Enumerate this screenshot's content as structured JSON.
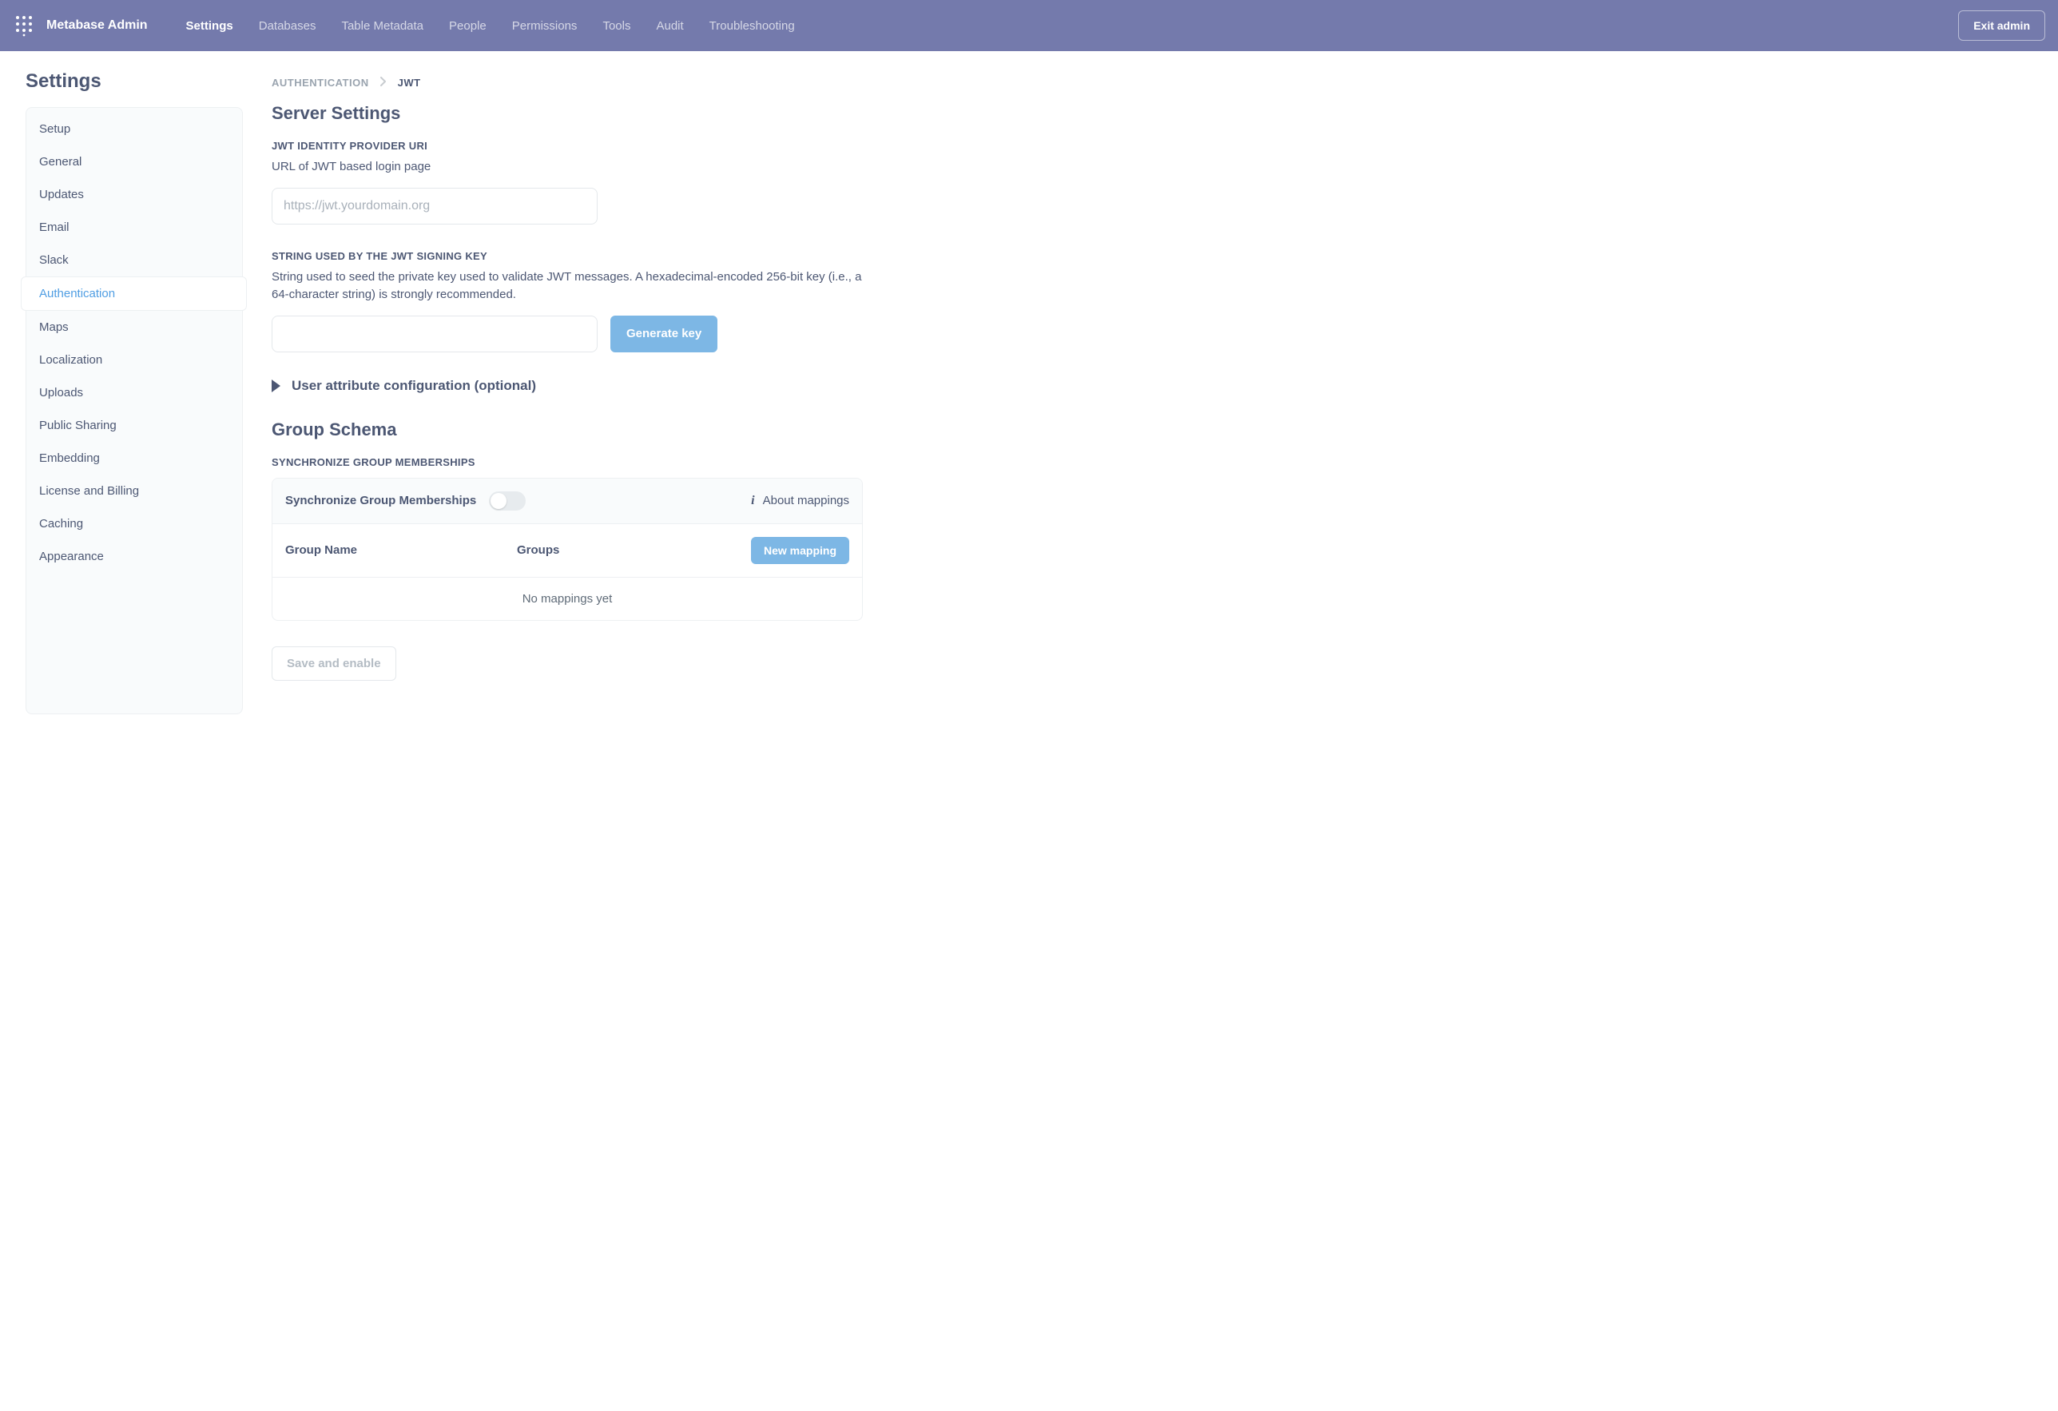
{
  "brand": "Metabase Admin",
  "nav": {
    "items": [
      "Settings",
      "Databases",
      "Table Metadata",
      "People",
      "Permissions",
      "Tools",
      "Audit",
      "Troubleshooting"
    ],
    "active_index": 0
  },
  "exit_label": "Exit admin",
  "page_title": "Settings",
  "sidebar": {
    "items": [
      "Setup",
      "General",
      "Updates",
      "Email",
      "Slack",
      "Authentication",
      "Maps",
      "Localization",
      "Uploads",
      "Public Sharing",
      "Embedding",
      "License and Billing",
      "Caching",
      "Appearance"
    ],
    "active_index": 5
  },
  "breadcrumb": {
    "parent": "AUTHENTICATION",
    "current": "JWT"
  },
  "sections": {
    "server_settings": "Server Settings",
    "group_schema": "Group Schema"
  },
  "jwt_uri": {
    "label": "JWT IDENTITY PROVIDER URI",
    "desc": "URL of JWT based login page",
    "placeholder": "https://jwt.yourdomain.org",
    "value": ""
  },
  "signing_key": {
    "label": "STRING USED BY THE JWT SIGNING KEY",
    "desc": "String used to seed the private key used to validate JWT messages. A hexadecimal-encoded 256-bit key (i.e., a 64-character string) is strongly recommended.",
    "value": "",
    "generate_btn": "Generate key"
  },
  "disclosure": {
    "label": "User attribute configuration (optional)"
  },
  "sync": {
    "section_label": "SYNCHRONIZE GROUP MEMBERSHIPS",
    "toggle_label": "Synchronize Group Memberships",
    "about_label": "About mappings",
    "col_group_name": "Group Name",
    "col_groups": "Groups",
    "new_mapping_btn": "New mapping",
    "empty": "No mappings yet"
  },
  "save_btn": "Save and enable"
}
